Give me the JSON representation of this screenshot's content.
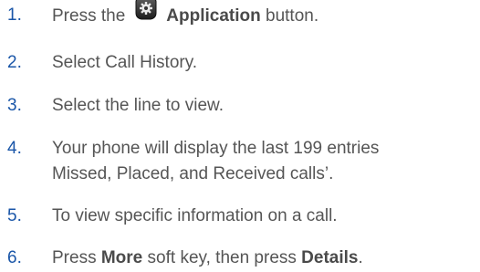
{
  "steps": [
    {
      "number": "1.",
      "parts": {
        "before": "Press the",
        "bold": "Application",
        "after": " button."
      },
      "icon": "gear-icon"
    },
    {
      "number": "2.",
      "text": "Select Call History."
    },
    {
      "number": "3.",
      "text": "Select the line to view."
    },
    {
      "number": "4.",
      "line1": "Your phone will display the last 199 entries",
      "line2": "Missed, Placed, and Received calls’."
    },
    {
      "number": "5.",
      "text": "To view specific information on a call."
    },
    {
      "number": "6.",
      "parts": {
        "before": "Press ",
        "bold1": "More",
        "middle": " soft key, then press ",
        "bold2": "Details",
        "after": "."
      }
    }
  ],
  "colors": {
    "number": "#1a56a8",
    "text": "#555555",
    "icon_body": "#2e2e2e"
  }
}
